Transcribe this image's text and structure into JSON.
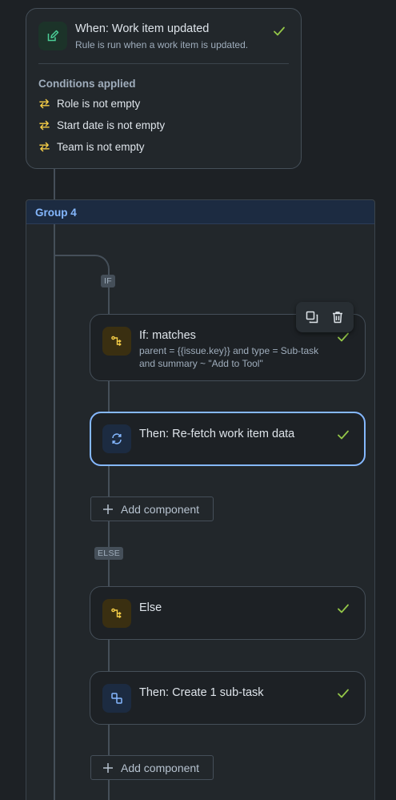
{
  "trigger": {
    "title": "When: Work item updated",
    "description": "Rule is run when a work item is updated.",
    "icon": "edit-icon",
    "status": "valid",
    "conditions_heading": "Conditions applied",
    "conditions": [
      {
        "label": "Role is not empty"
      },
      {
        "label": "Start date is not empty"
      },
      {
        "label": "Team is not empty"
      }
    ]
  },
  "group": {
    "title": "Group 4",
    "if_label": "IF",
    "else_label": "ELSE",
    "toolbar": {
      "copy_icon": "copy-icon",
      "delete_icon": "trash-icon"
    },
    "steps": [
      {
        "title": "If: matches",
        "description": "parent = {{issue.key}} and type = Sub-task and summary ~ \"Add to Tool\"",
        "icon": "branch-icon",
        "status": "valid"
      },
      {
        "title": "Then: Re-fetch work item data",
        "icon": "refresh-icon",
        "status": "valid",
        "selected": true
      },
      {
        "title": "Else",
        "icon": "branch-icon",
        "status": "valid"
      },
      {
        "title": "Then: Create 1 sub-task",
        "icon": "subtask-icon",
        "status": "valid"
      }
    ],
    "add_component_label": "Add component"
  },
  "colors": {
    "background": "#1d2125",
    "accent_blue": "#85b8ff",
    "check_green": "#94c748",
    "condition_yellow": "#f5cd47"
  }
}
